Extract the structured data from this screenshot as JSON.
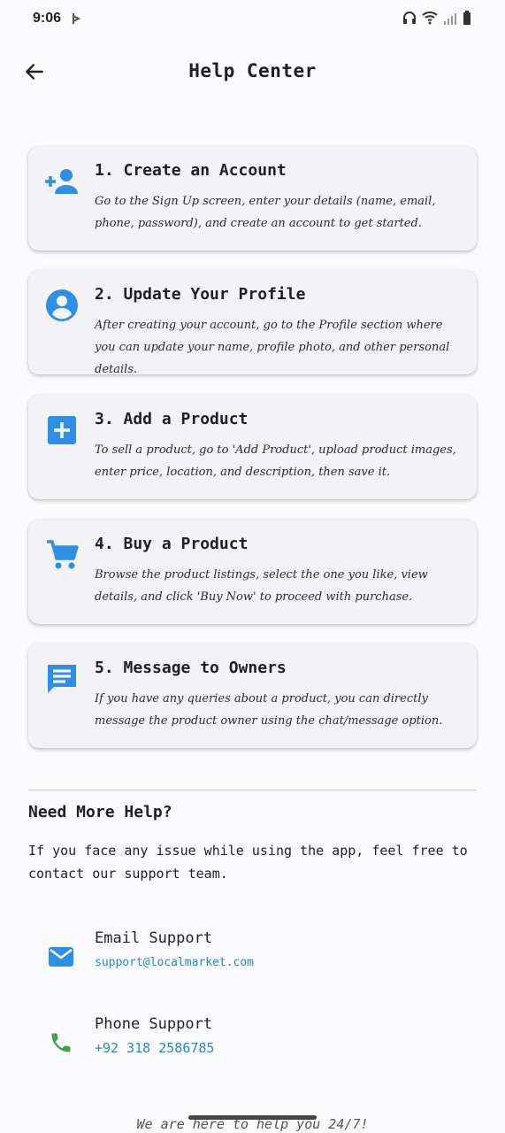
{
  "status_bar": {
    "time": "9:06"
  },
  "header": {
    "title": "Help Center"
  },
  "steps": [
    {
      "title": "1. Create an Account",
      "desc": "Go to the Sign Up screen, enter your details (name, email, phone, password), and create an account to get started.",
      "icon": "person-add-icon"
    },
    {
      "title": "2. Update Your Profile",
      "desc": "After creating your account, go to the Profile section where you can update your name, profile photo, and other personal details.",
      "icon": "account-circle-icon"
    },
    {
      "title": "3. Add a Product",
      "desc": "To sell a product, go to 'Add Product', upload product images, enter price, location, and description, then save it.",
      "icon": "add-box-icon"
    },
    {
      "title": "4. Buy a Product",
      "desc": "Browse the product listings, select the one you like, view details, and click 'Buy Now' to proceed with purchase.",
      "icon": "shopping-cart-icon"
    },
    {
      "title": "5. Message to Owners",
      "desc": "If you have any queries about a product, you can directly message the product owner using the chat/message option.",
      "icon": "message-icon"
    }
  ],
  "help": {
    "heading": "Need More Help?",
    "text": "If you face any issue while using the app, feel free to contact our support team."
  },
  "support": {
    "email": {
      "label": "Email Support",
      "value": "support@localmarket.com"
    },
    "phone": {
      "label": "Phone Support",
      "value": "+92 318 2586785"
    }
  },
  "footer": {
    "note": "We are here to help you 24/7!"
  },
  "colors": {
    "accent_blue": "#2f8fe6",
    "phone_green": "#43a047",
    "link_blue": "#2f86c6"
  }
}
